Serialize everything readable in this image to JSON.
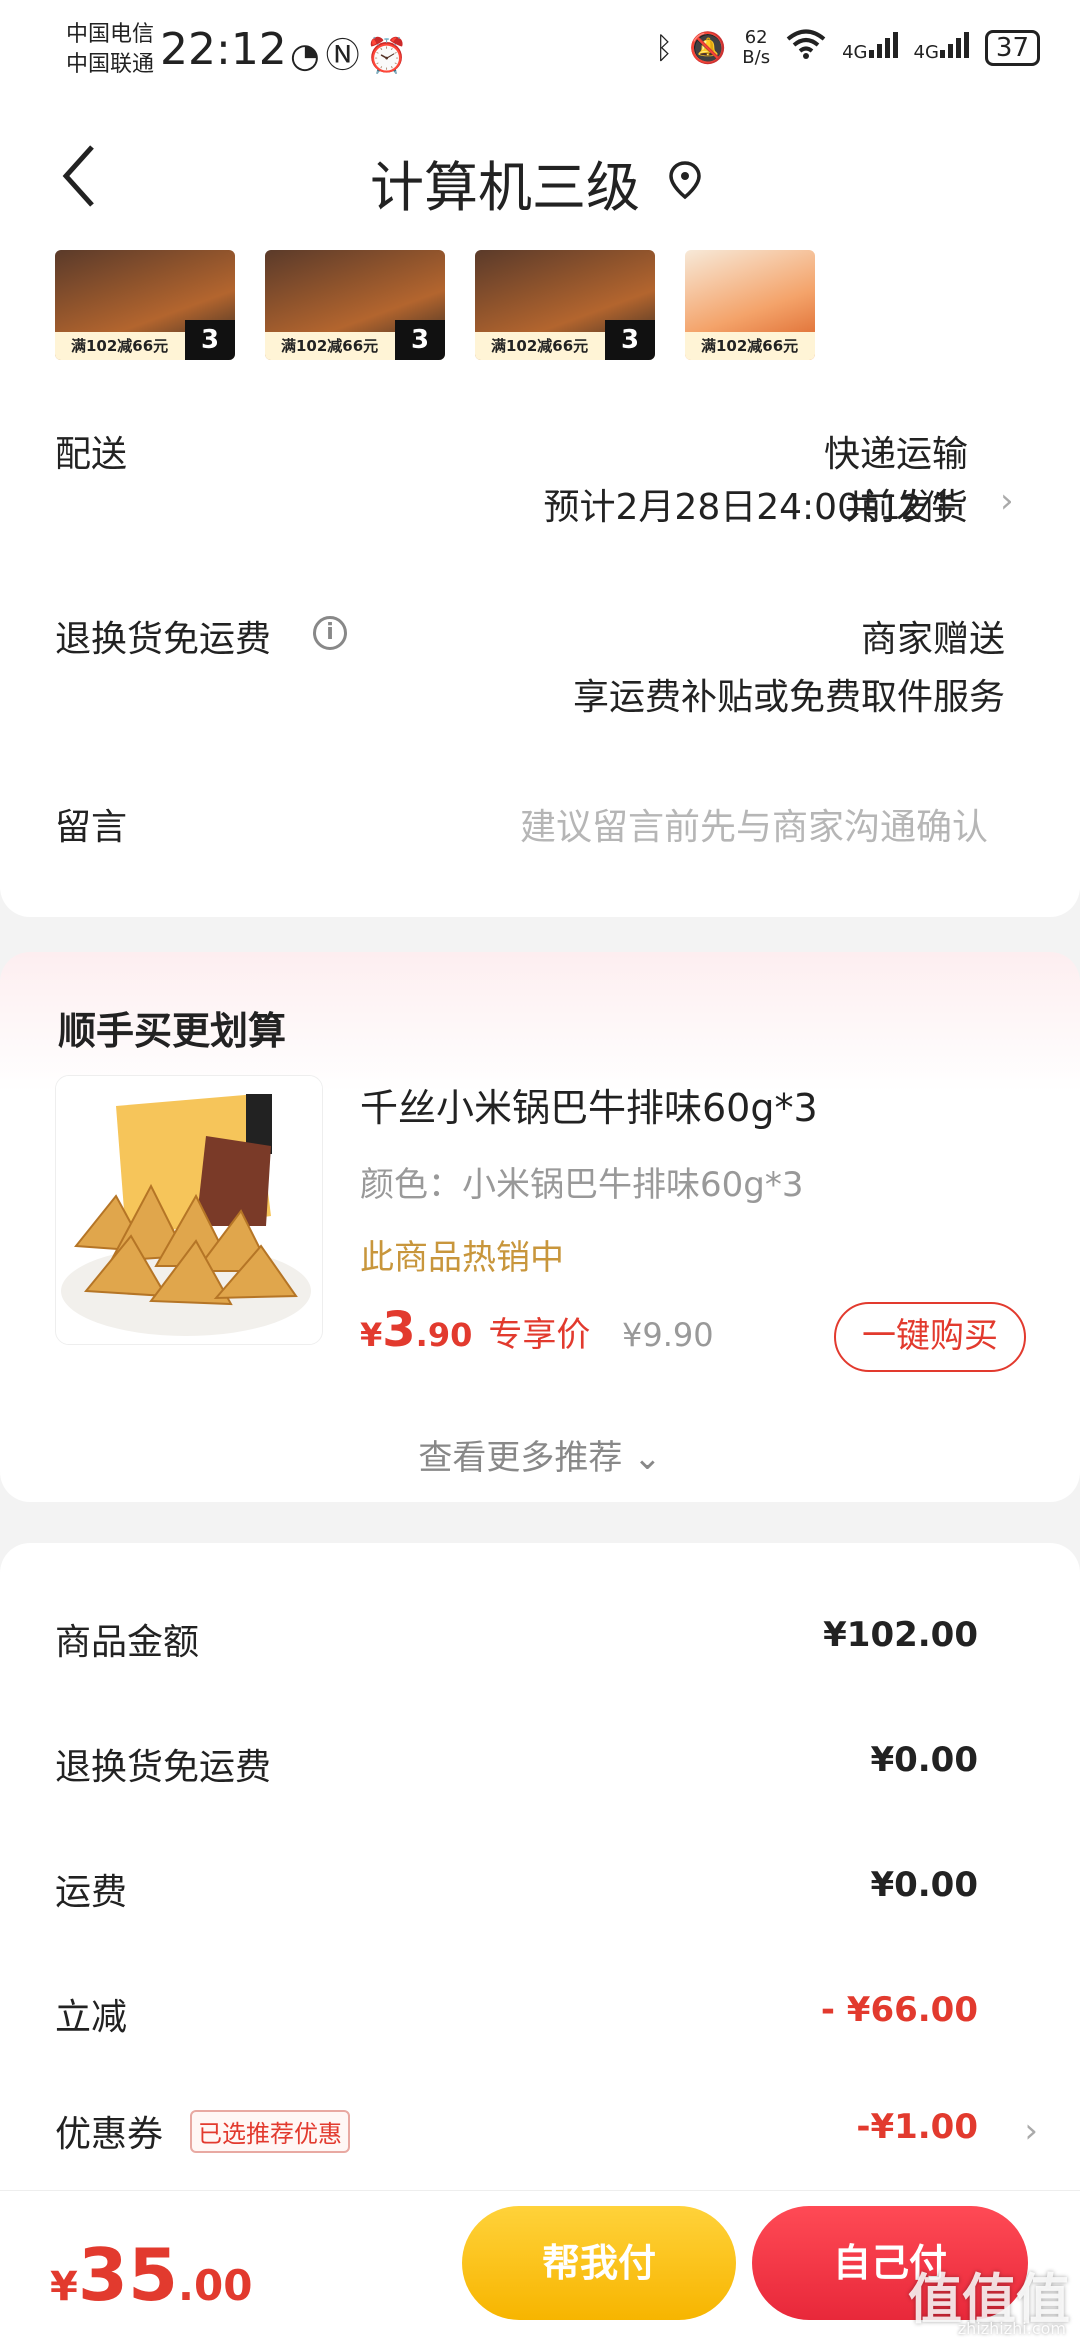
{
  "status_bar": {
    "carrier1": "中国电信",
    "carrier2": "中国联通",
    "time": "22:12",
    "speed_value": "62",
    "speed_unit": "B/s",
    "net1": "4G",
    "net2": "4G",
    "battery": "37"
  },
  "nav": {
    "title": "计算机三级"
  },
  "order_items": {
    "thumb_strip": "满102减66元",
    "thumb_badge": "3",
    "count": "共12件"
  },
  "delivery": {
    "label": "配送",
    "method": "快递运输",
    "estimate": "预计2月28日24:00前发货"
  },
  "return_fee": {
    "label": "退换货免运费",
    "provider": "商家赠送",
    "desc": "享运费补贴或免费取件服务"
  },
  "message": {
    "label": "留言",
    "placeholder": "建议留言前先与商家沟通确认"
  },
  "recommend": {
    "title": "顺手买更划算",
    "product_name": "千丝小米锅巴牛排味60g*3",
    "variant": "颜色：小米锅巴牛排味60g*3",
    "hot": "此商品热销中",
    "price_currency": "¥",
    "price_int": "3",
    "price_dec": ".90",
    "price_tag": "专享价",
    "original_price": "¥9.90",
    "buy_label": "一键购买",
    "more_label": "查看更多推荐"
  },
  "summary": {
    "rows": [
      {
        "label": "商品金额",
        "value": "¥102.00"
      },
      {
        "label": "退换货免运费",
        "value": "¥0.00"
      },
      {
        "label": "运费",
        "value": "¥0.00"
      },
      {
        "label": "立减",
        "value": "- ¥66.00"
      },
      {
        "label": "优惠券",
        "value": "-¥1.00"
      }
    ],
    "coupon_tag": "已选推荐优惠"
  },
  "bottom": {
    "currency": "¥",
    "total_int": "35",
    "total_dec": ".00",
    "help_pay": "帮我付",
    "self_pay": "自己付",
    "watermark": "值值值",
    "watermark_url": "zhizhizhi.com"
  },
  "colors": {
    "accent_red": "#e23a2e",
    "accent_yellow": "#f7b500",
    "hot_gold": "#c8963c"
  }
}
